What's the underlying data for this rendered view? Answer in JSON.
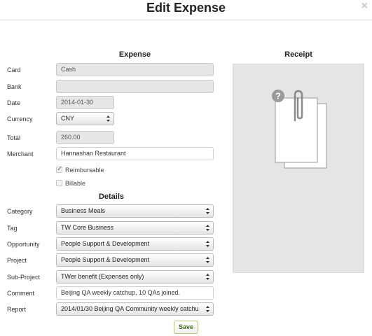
{
  "modal": {
    "title": "Edit Expense",
    "close_icon": "×"
  },
  "expense_section": {
    "heading": "Expense"
  },
  "receipt_section": {
    "heading": "Receipt",
    "placeholder_icon": "question-paperclip-document-icon"
  },
  "fields": {
    "card": {
      "label": "Card",
      "value": "Cash"
    },
    "bank": {
      "label": "Bank",
      "value": ""
    },
    "date": {
      "label": "Date",
      "value": "2014-01-30"
    },
    "currency": {
      "label": "Currency",
      "value": "CNY"
    },
    "total": {
      "label": "Total",
      "value": "260.00"
    },
    "merchant": {
      "label": "Merchant",
      "value": "Hannashan Restaurant"
    }
  },
  "checkboxes": {
    "reimbursable": {
      "label": "Reimbursable",
      "checked": true
    },
    "billable": {
      "label": "Billable",
      "checked": false
    }
  },
  "details_section": {
    "heading": "Details"
  },
  "details": {
    "category": {
      "label": "Category",
      "value": "Business Meals"
    },
    "tag": {
      "label": "Tag",
      "value": "TW Core Business"
    },
    "opportunity": {
      "label": "Opportunity",
      "value": "People Support & Development"
    },
    "project": {
      "label": "Project",
      "value": "People Support & Development"
    },
    "subproject": {
      "label": "Sub-Project",
      "value": "TWer benefit (Expenses only)"
    },
    "comment": {
      "label": "Comment",
      "value": "Beijing QA weekly catchup, 10 QAs joined."
    },
    "report": {
      "label": "Report",
      "value": "2014/01/30 Beijing QA Community weekly catchu"
    }
  },
  "actions": {
    "save_label": "Save"
  },
  "colors": {
    "receipt_bg": "#e5e5e5",
    "save_text": "#3d6b1a",
    "readonly_bg": "#e6e6e6"
  }
}
